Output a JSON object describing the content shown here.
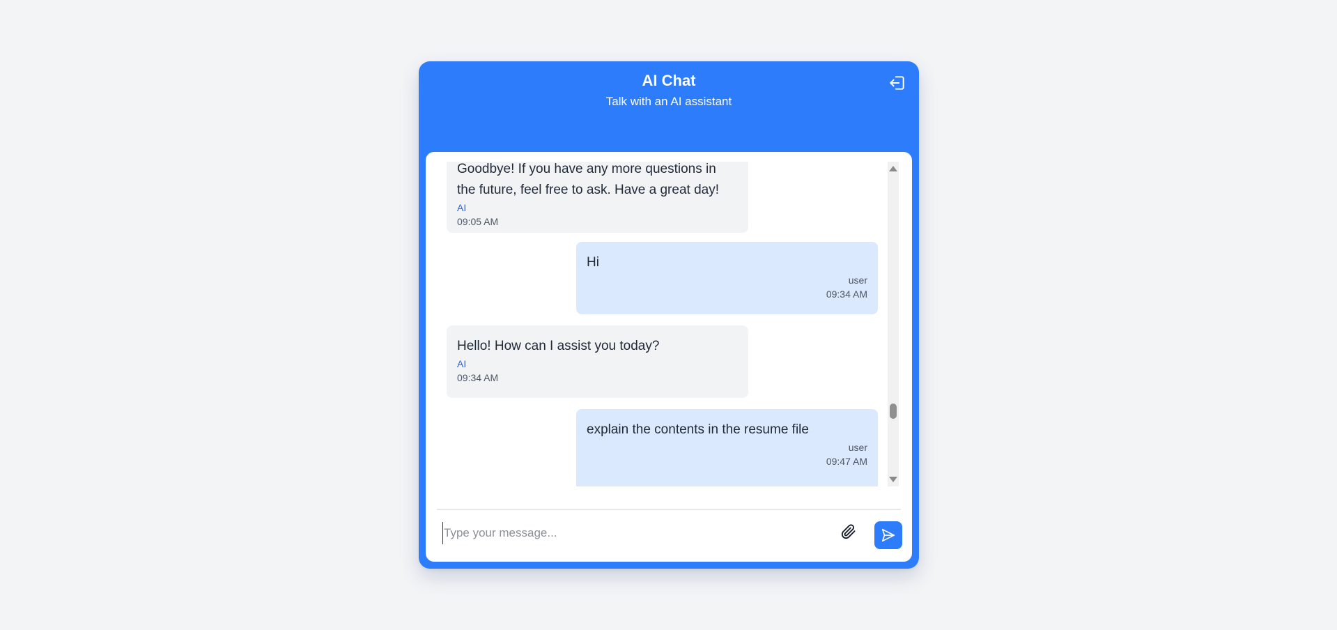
{
  "header": {
    "title": "AI Chat",
    "subtitle": "Talk with an AI assistant",
    "logout_icon": "logout-icon"
  },
  "messages": [
    {
      "role": "ai",
      "text": "Goodbye! If you have any more questions in the future, feel free to ask. Have a great day!",
      "sender": "AI",
      "time": "09:05 AM"
    },
    {
      "role": "user",
      "text": "Hi",
      "sender": "user",
      "time": "09:34 AM"
    },
    {
      "role": "ai",
      "text": "Hello! How can I assist you today?",
      "sender": "AI",
      "time": "09:34 AM"
    },
    {
      "role": "user",
      "text": "explain the contents in the resume file",
      "sender": "user",
      "time": "09:47 AM"
    }
  ],
  "composer": {
    "placeholder": "Type your message...",
    "attach_icon": "paperclip-icon",
    "send_icon": "send-icon"
  },
  "colors": {
    "accent": "#2d7cfb",
    "user_bubble": "#dbe9fe",
    "ai_bubble": "#f2f3f5"
  }
}
